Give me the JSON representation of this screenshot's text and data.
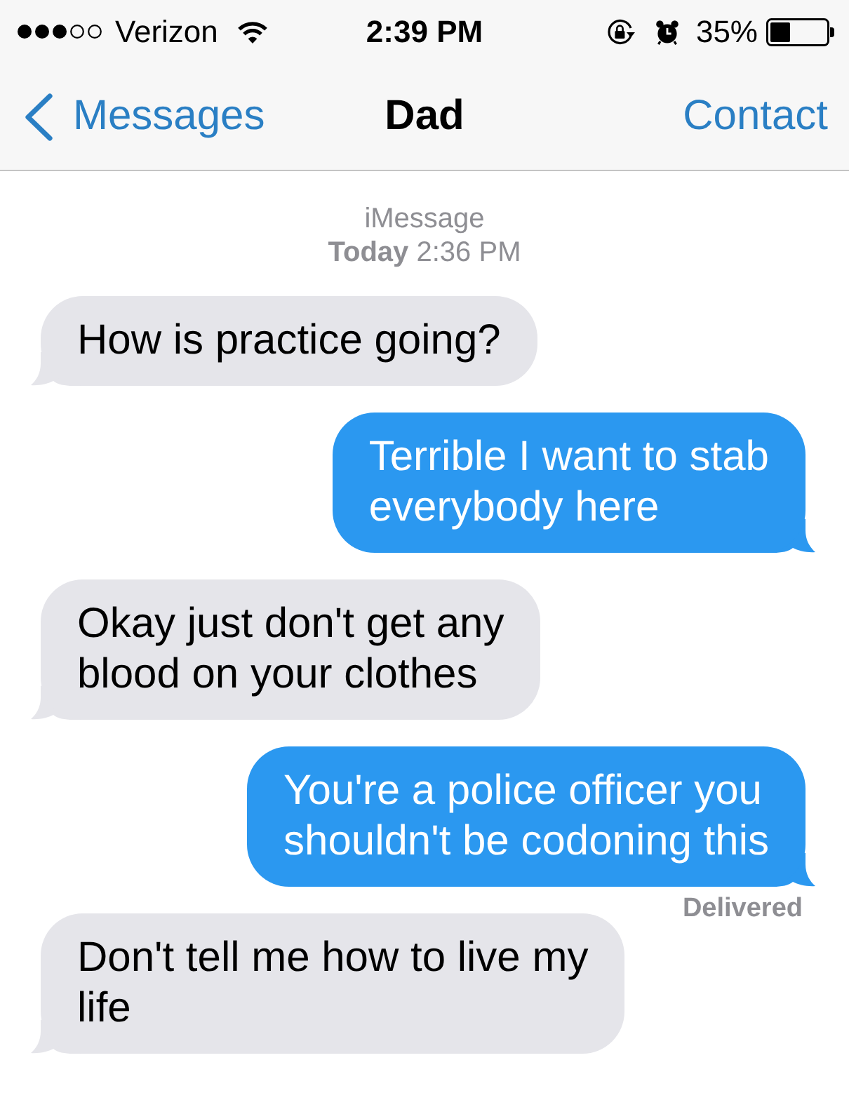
{
  "status_bar": {
    "carrier": "Verizon",
    "time": "2:39 PM",
    "battery_percent": "35%"
  },
  "nav_bar": {
    "back_label": "Messages",
    "title": "Dad",
    "action_label": "Contact"
  },
  "conversation": {
    "service": "iMessage",
    "timestamp": "**Today** 2:36 PM",
    "messages": [
      {
        "kind": "received",
        "text": "How is practice going?"
      },
      {
        "kind": "sent",
        "text": "Terrible I want to stab\neverybody here"
      },
      {
        "kind": "received",
        "text": "Okay just don't get any\nblood on your clothes"
      },
      {
        "kind": "sent",
        "text": "You're a police officer you\nshouldn't be codoning this",
        "receipt": "Delivered"
      },
      {
        "kind": "received",
        "text": "Don't tell me how to live my\nlife"
      }
    ]
  }
}
